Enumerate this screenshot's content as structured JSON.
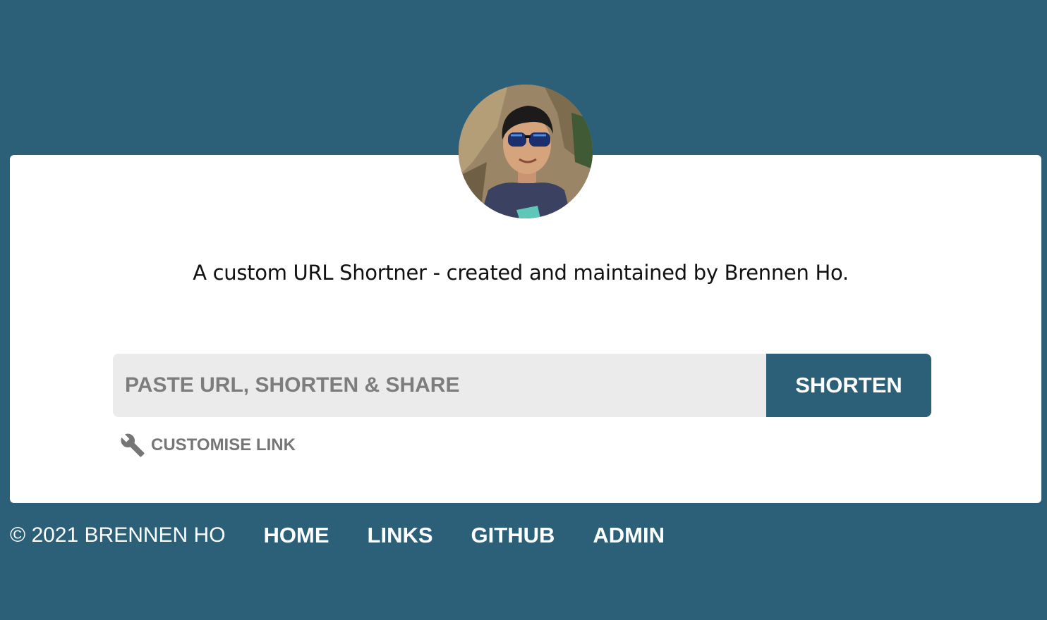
{
  "theme": {
    "primary_color": "#2c6079",
    "card_background": "#ffffff",
    "input_background": "#ebebeb"
  },
  "header": {
    "avatar_icon": "profile-photo"
  },
  "main": {
    "tagline": "A custom URL Shortner - created and maintained by Brennen Ho.",
    "url_input": {
      "value": "",
      "placeholder": "PASTE URL, SHORTEN & SHARE"
    },
    "shorten_label": "SHORTEN",
    "customise": {
      "icon": "wrench-icon",
      "label": "CUSTOMISE LINK"
    }
  },
  "footer": {
    "copyright": "© 2021 BRENNEN HO",
    "nav": [
      {
        "label": "HOME"
      },
      {
        "label": "LINKS"
      },
      {
        "label": "GITHUB"
      },
      {
        "label": "ADMIN"
      }
    ]
  }
}
